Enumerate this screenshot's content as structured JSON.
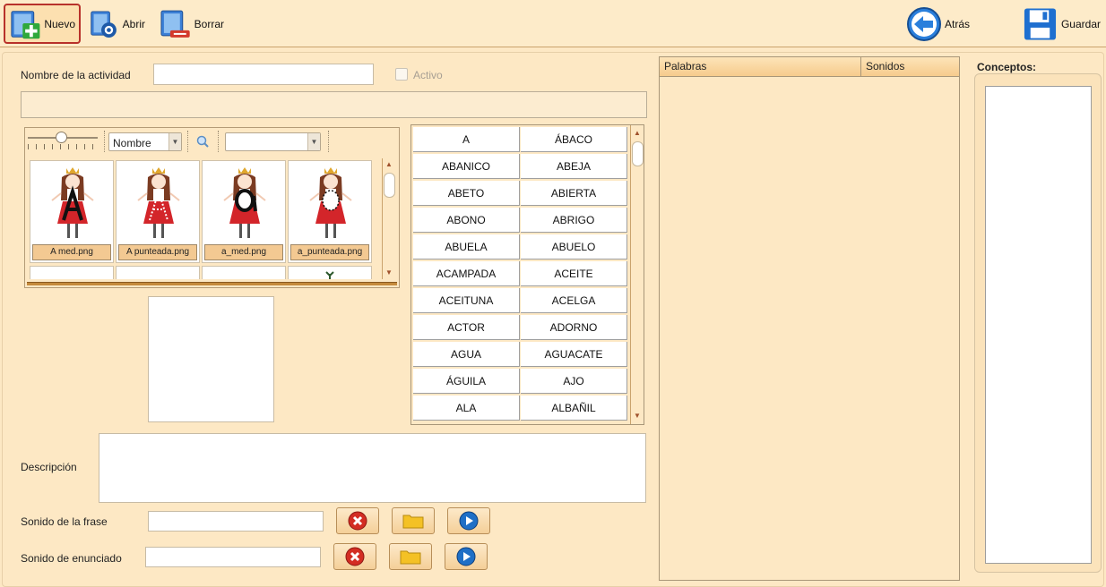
{
  "toolbar": {
    "nuevo": "Nuevo",
    "abrir": "Abrir",
    "borrar": "Borrar",
    "atras": "Atrás",
    "guardar": "Guardar"
  },
  "form": {
    "nombre_label": "Nombre de la actividad",
    "nombre_value": "",
    "activo_label": "Activo",
    "descripcion_label": "Descripción",
    "sonido_frase_label": "Sonido de la frase",
    "sonido_enunciado_label": "Sonido de enunciado"
  },
  "browser": {
    "sort_value": "Nombre",
    "filter_value": "",
    "thumbs": [
      {
        "caption": "A med.png",
        "mark": "A"
      },
      {
        "caption": "A punteada.png",
        "mark": "A-dotted"
      },
      {
        "caption": "a_med.png",
        "mark": "a"
      },
      {
        "caption": "a_punteada.png",
        "mark": "a-dotted"
      }
    ]
  },
  "words_grid": [
    [
      "A",
      "ÁBACO"
    ],
    [
      "ABANICO",
      "ABEJA"
    ],
    [
      "ABETO",
      "ABIERTA"
    ],
    [
      "ABONO",
      "ABRIGO"
    ],
    [
      "ABUELA",
      "ABUELO"
    ],
    [
      "ACAMPADA",
      "ACEITE"
    ],
    [
      "ACEITUNA",
      "ACELGA"
    ],
    [
      "ACTOR",
      "ADORNO"
    ],
    [
      "AGUA",
      "AGUACATE"
    ],
    [
      "ÁGUILA",
      "AJO"
    ],
    [
      "ALA",
      "ALBAÑIL"
    ]
  ],
  "words_table": {
    "col_palabras": "Palabras",
    "col_sonidos": "Sonidos"
  },
  "concepts": {
    "label": "Conceptos:"
  },
  "colors": {
    "background": "#fde8c4",
    "accent_border": "#b8312a"
  }
}
